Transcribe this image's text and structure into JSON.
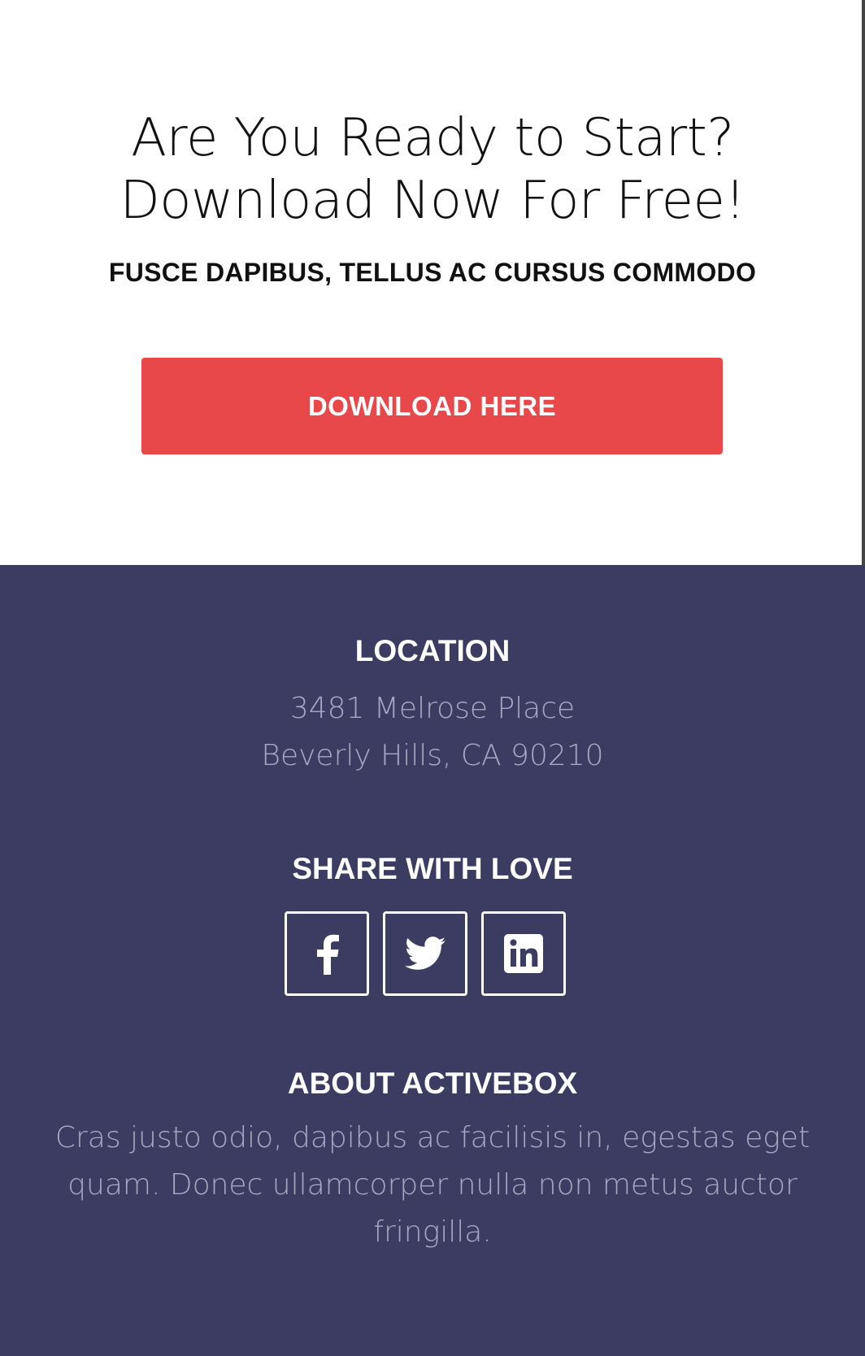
{
  "cta": {
    "title_line1": "Are You Ready to Start?",
    "title_line2": "Download Now For Free!",
    "subtitle": "FUSCE DAPIBUS, TELLUS AC CURSUS COMMODO",
    "button_label": "DOWNLOAD HERE"
  },
  "footer": {
    "location": {
      "heading": "LOCATION",
      "address_line1": "3481 Melrose Place",
      "address_line2": "Beverly Hills, CA 90210"
    },
    "share": {
      "heading": "SHARE WITH LOVE",
      "icons": [
        "facebook-icon",
        "twitter-icon",
        "linkedin-icon"
      ]
    },
    "about": {
      "heading": "ABOUT ACTIVEBOX",
      "text_line1": "Cras justo odio, dapibus ac facilisis in, egestas eget",
      "text_line2": "quam. Donec ullamcorper nulla non metus auctor",
      "text_line3": "fringilla."
    }
  },
  "colors": {
    "cta_background": "#ffffff",
    "button": "#e8484a",
    "footer_background": "#3c3c62",
    "footer_heading": "#ffffff",
    "footer_text": "#a8a8c4"
  }
}
